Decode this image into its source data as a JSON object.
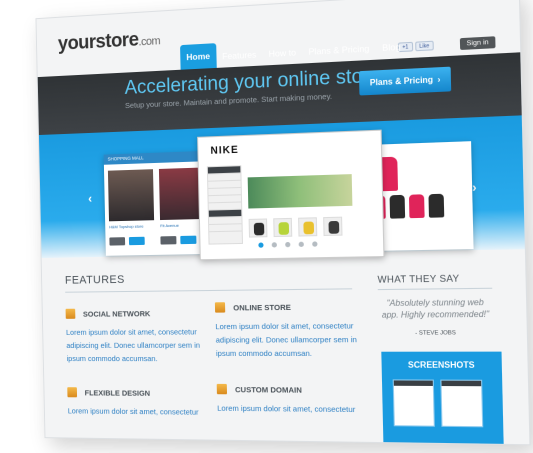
{
  "header": {
    "logo_main": "yourstore",
    "logo_tld": ".com",
    "nav": [
      "Home",
      "Features",
      "How to",
      "Plans & Pricing",
      "Blog"
    ],
    "social": [
      "+1",
      "Like"
    ],
    "signin": "Sign in"
  },
  "hero": {
    "title": "Accelerating your online store.",
    "subtitle": "Setup your store. Maintain and promote. Start making money.",
    "cta": "Plans & Pricing",
    "cta_arrow": "›"
  },
  "slider": {
    "prev": "‹",
    "next": "›",
    "left_card_header": "SHOPPING MALL",
    "left_card_caption_a": "H&M Topshop store",
    "left_card_caption_b": "Fit Avenue",
    "main_brand": "NIKE",
    "dots": 5,
    "active_dot": 0
  },
  "features": {
    "title": "FEATURES",
    "items": [
      {
        "name": "SOCIAL NETWORK",
        "desc": "Lorem ipsum dolor sit amet, consectetur adipiscing elit. Donec ullamcorper sem in ipsum commodo accumsan."
      },
      {
        "name": "ONLINE STORE",
        "desc": "Lorem ipsum dolor sit amet, consectetur adipiscing elit. Donec ullamcorper sem in ipsum commodo accumsan."
      },
      {
        "name": "FLEXIBLE DESIGN",
        "desc": "Lorem ipsum dolor sit amet, consectetur"
      },
      {
        "name": "CUSTOM DOMAIN",
        "desc": "Lorem ipsum dolor sit amet, consectetur"
      }
    ]
  },
  "sidebar": {
    "title": "WHAT THEY SAY",
    "quote": "\"Absolutely stunning web app. Highly recommended!\"",
    "author": "- STEVE JOBS",
    "screenshots": "SCREENSHOTS"
  },
  "colors": {
    "accent": "#1a9be0",
    "dark_band": "#34383c",
    "link": "#2e80c4",
    "icon": "#e8a23a"
  }
}
